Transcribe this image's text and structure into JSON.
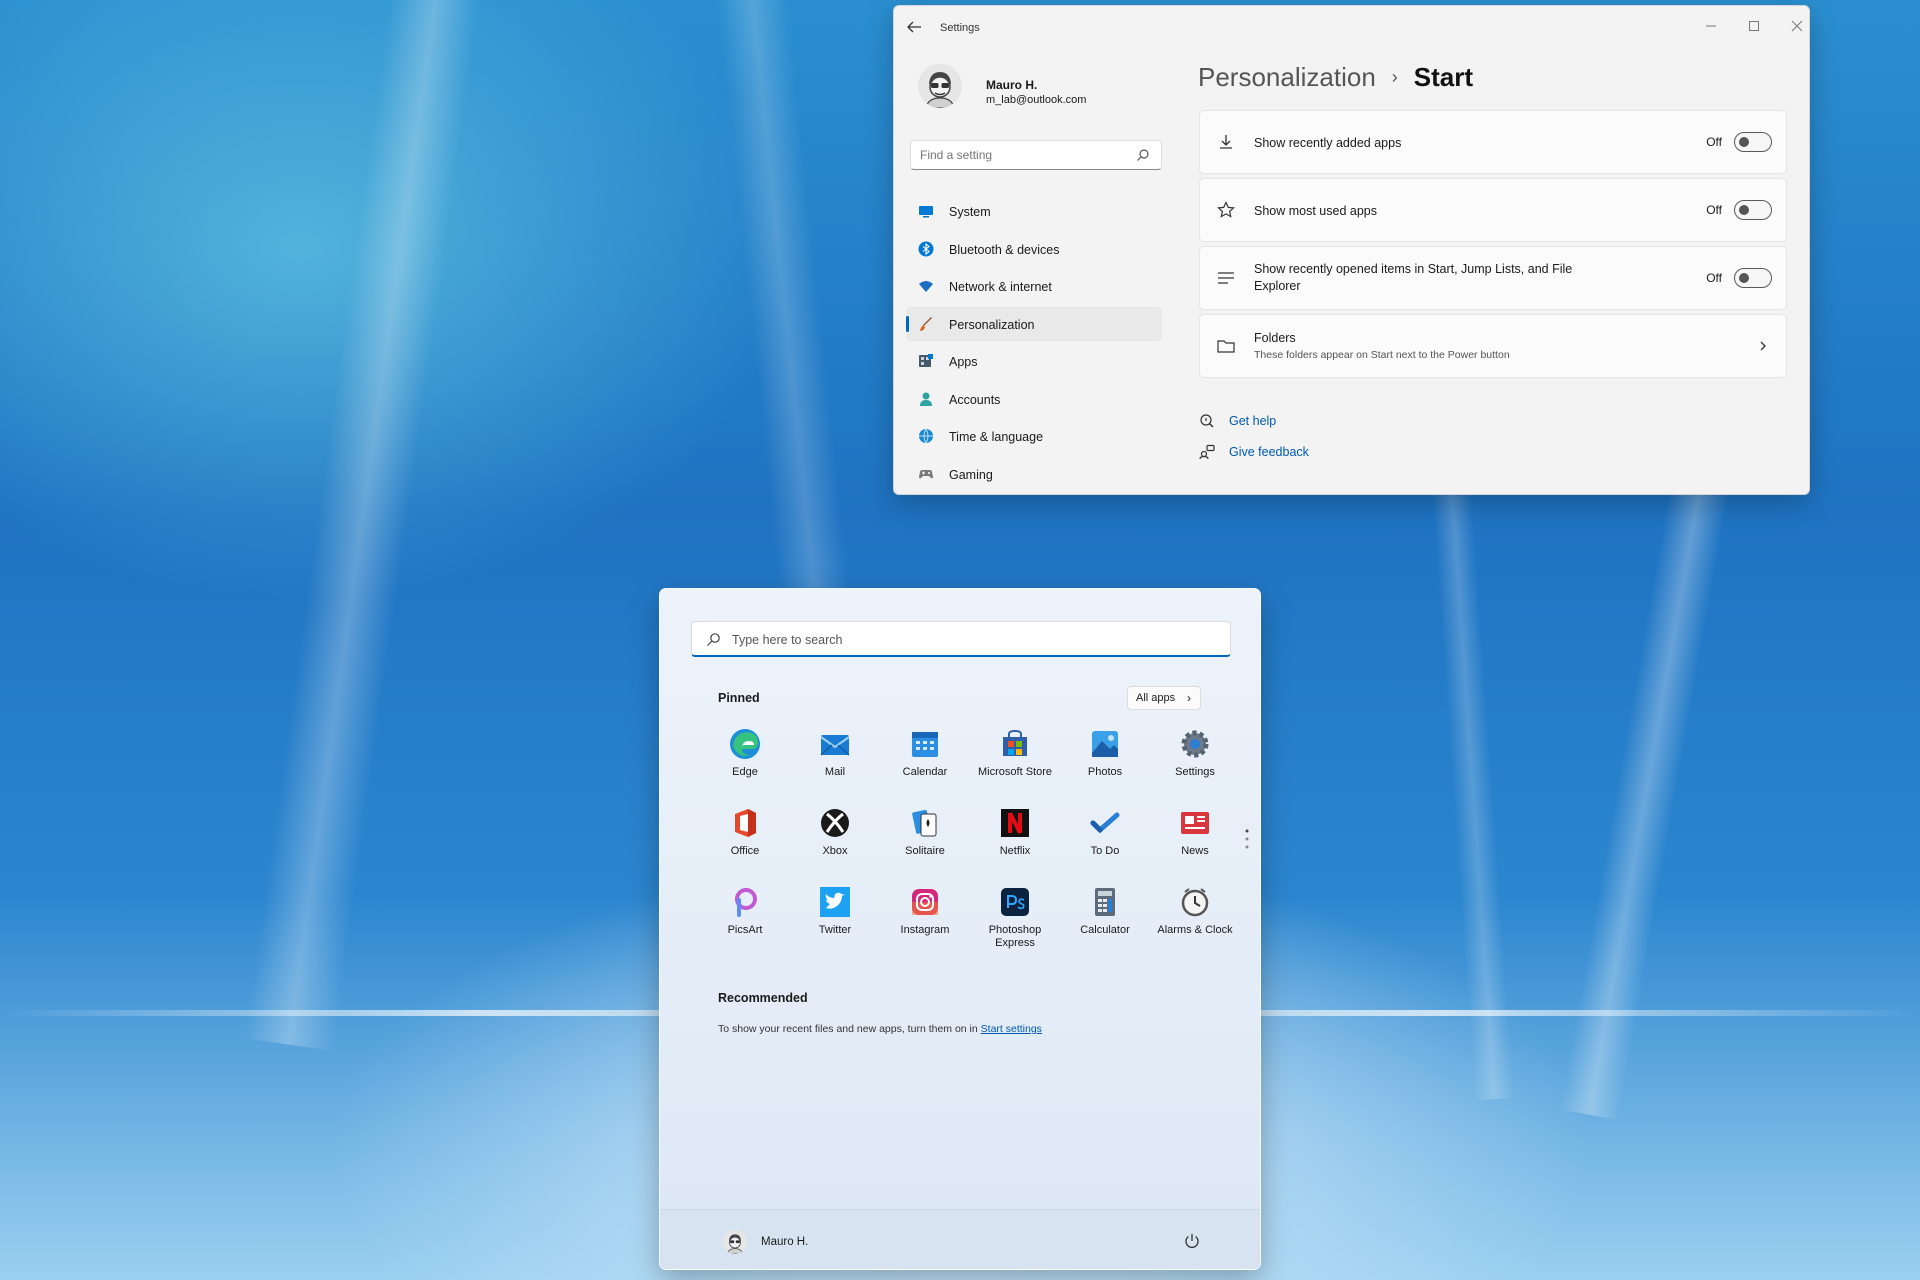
{
  "settings": {
    "window_title": "Settings",
    "user": {
      "name": "Mauro H.",
      "email": "m_lab@outlook.com"
    },
    "search_placeholder": "Find a setting",
    "nav": [
      {
        "label": "System",
        "icon": "monitor-icon",
        "color": "#0078d4"
      },
      {
        "label": "Bluetooth & devices",
        "icon": "bluetooth-icon",
        "color": "#0078d4"
      },
      {
        "label": "Network & internet",
        "icon": "wifi-icon",
        "color": "#1b6ec2"
      },
      {
        "label": "Personalization",
        "icon": "brush-icon",
        "color": "#d9652b",
        "active": true
      },
      {
        "label": "Apps",
        "icon": "apps-icon",
        "color": "#45596b"
      },
      {
        "label": "Accounts",
        "icon": "person-icon",
        "color": "#2ea3a1"
      },
      {
        "label": "Time & language",
        "icon": "globe-icon",
        "color": "#1b88d6"
      },
      {
        "label": "Gaming",
        "icon": "controller-icon",
        "color": "#7a7a7a"
      }
    ],
    "breadcrumb": {
      "parent": "Personalization",
      "separator": "›",
      "current": "Start"
    },
    "options": [
      {
        "label": "Show recently added apps",
        "state": "Off",
        "icon": "download-icon"
      },
      {
        "label": "Show most used apps",
        "state": "Off",
        "icon": "star-icon"
      },
      {
        "label": "Show recently opened items in Start, Jump Lists, and File Explorer",
        "state": "Off",
        "icon": "list-icon"
      }
    ],
    "folders": {
      "label": "Folders",
      "description": "These folders appear on Start next to the Power button",
      "icon": "folder-icon"
    },
    "links": {
      "help": "Get help",
      "feedback": "Give feedback"
    },
    "accent_color": "#0067c0"
  },
  "start": {
    "search_placeholder": "Type here to search",
    "pinned_title": "Pinned",
    "all_apps_label": "All apps",
    "all_apps_arrow": "›",
    "apps": [
      {
        "name": "Edge",
        "icon": "edge-icon"
      },
      {
        "name": "Mail",
        "icon": "mail-icon"
      },
      {
        "name": "Calendar",
        "icon": "calendar-icon"
      },
      {
        "name": "Microsoft Store",
        "icon": "store-icon"
      },
      {
        "name": "Photos",
        "icon": "photos-icon"
      },
      {
        "name": "Settings",
        "icon": "settings-gear-icon"
      },
      {
        "name": "Office",
        "icon": "office-icon"
      },
      {
        "name": "Xbox",
        "icon": "xbox-icon"
      },
      {
        "name": "Solitaire",
        "icon": "solitaire-icon"
      },
      {
        "name": "Netflix",
        "icon": "netflix-icon"
      },
      {
        "name": "To Do",
        "icon": "todo-icon"
      },
      {
        "name": "News",
        "icon": "news-icon"
      },
      {
        "name": "PicsArt",
        "icon": "picsart-icon"
      },
      {
        "name": "Twitter",
        "icon": "twitter-icon"
      },
      {
        "name": "Instagram",
        "icon": "instagram-icon"
      },
      {
        "name": "Photoshop Express",
        "icon": "photoshop-icon"
      },
      {
        "name": "Calculator",
        "icon": "calculator-icon"
      },
      {
        "name": "Alarms & Clock",
        "icon": "clock-icon"
      }
    ],
    "recommended_title": "Recommended",
    "recommended_text": "To show your recent files and new apps, turn them on in",
    "recommended_link": "Start settings",
    "user_name": "Mauro H."
  }
}
